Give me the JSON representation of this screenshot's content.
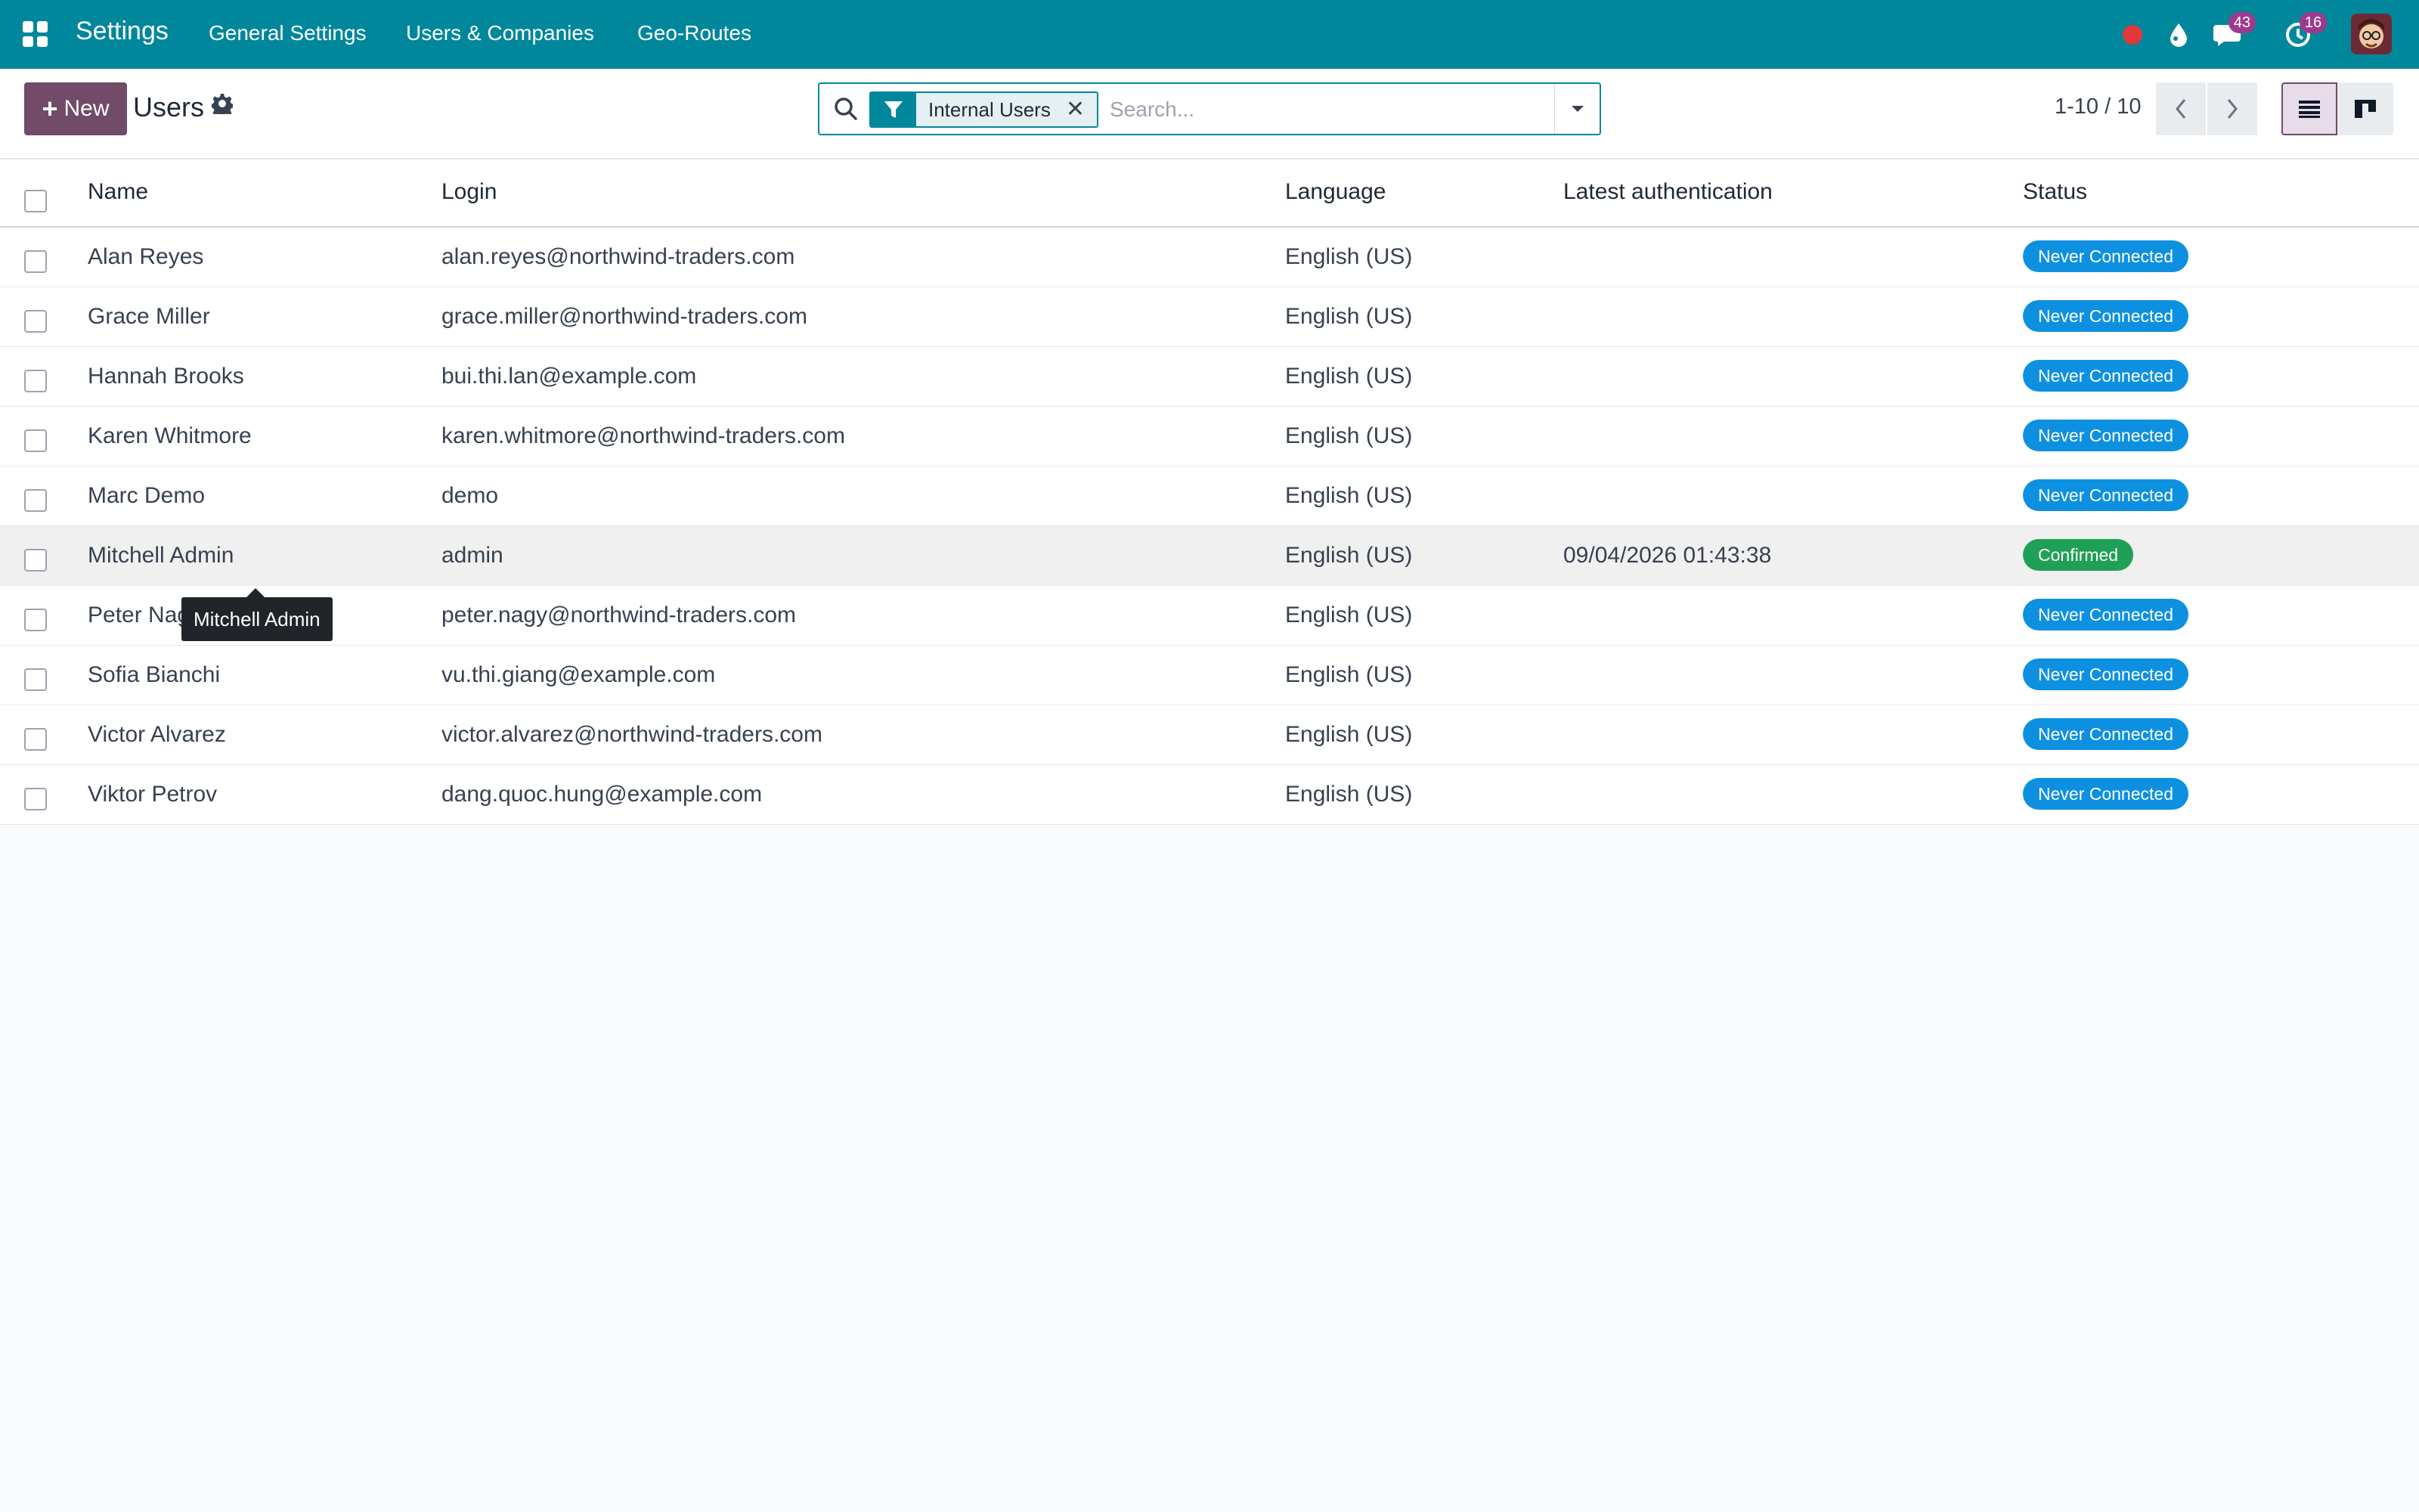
{
  "navbar": {
    "app_title": "Settings",
    "menu": [
      "General Settings",
      "Users & Companies",
      "Geo-Routes"
    ],
    "icons": [
      "apps-grid-icon",
      "record-dot-icon",
      "droplet-icon",
      "chat-icon",
      "activity-clock-icon"
    ],
    "messages_count": "43",
    "activities_count": "16",
    "accent_color": "#01879b"
  },
  "control": {
    "new_label": "New",
    "breadcrumb": "Users",
    "search": {
      "facet_label": "Internal Users",
      "placeholder": "Search..."
    },
    "pager": "1-10 / 10"
  },
  "table": {
    "columns": [
      "Name",
      "Login",
      "Language",
      "Latest authentication",
      "Status"
    ],
    "rows": [
      {
        "name": "Alan Reyes",
        "login": "alan.reyes@northwind-traders.com",
        "language": "English (US)",
        "latest_auth": "",
        "status": "Never Connected"
      },
      {
        "name": "Grace Miller",
        "login": "grace.miller@northwind-traders.com",
        "language": "English (US)",
        "latest_auth": "",
        "status": "Never Connected"
      },
      {
        "name": "Hannah Brooks",
        "login": "bui.thi.lan@example.com",
        "language": "English (US)",
        "latest_auth": "",
        "status": "Never Connected"
      },
      {
        "name": "Karen Whitmore",
        "login": "karen.whitmore@northwind-traders.com",
        "language": "English (US)",
        "latest_auth": "",
        "status": "Never Connected"
      },
      {
        "name": "Marc Demo",
        "login": "demo",
        "language": "English (US)",
        "latest_auth": "",
        "status": "Never Connected"
      },
      {
        "name": "Mitchell Admin",
        "login": "admin",
        "language": "English (US)",
        "latest_auth": "09/04/2026 01:43:38",
        "status": "Confirmed"
      },
      {
        "name": "Peter Nagy",
        "login": "peter.nagy@northwind-traders.com",
        "language": "English (US)",
        "latest_auth": "",
        "status": "Never Connected"
      },
      {
        "name": "Sofia Bianchi",
        "login": "vu.thi.giang@example.com",
        "language": "English (US)",
        "latest_auth": "",
        "status": "Never Connected"
      },
      {
        "name": "Victor Alvarez",
        "login": "victor.alvarez@northwind-traders.com",
        "language": "English (US)",
        "latest_auth": "",
        "status": "Never Connected"
      },
      {
        "name": "Viktor Petrov",
        "login": "dang.quoc.hung@example.com",
        "language": "English (US)",
        "latest_auth": "",
        "status": "Never Connected"
      }
    ]
  },
  "tooltip": "Mitchell Admin",
  "status_colors": {
    "Never Connected": "#0e90e0",
    "Confirmed": "#20a056"
  }
}
